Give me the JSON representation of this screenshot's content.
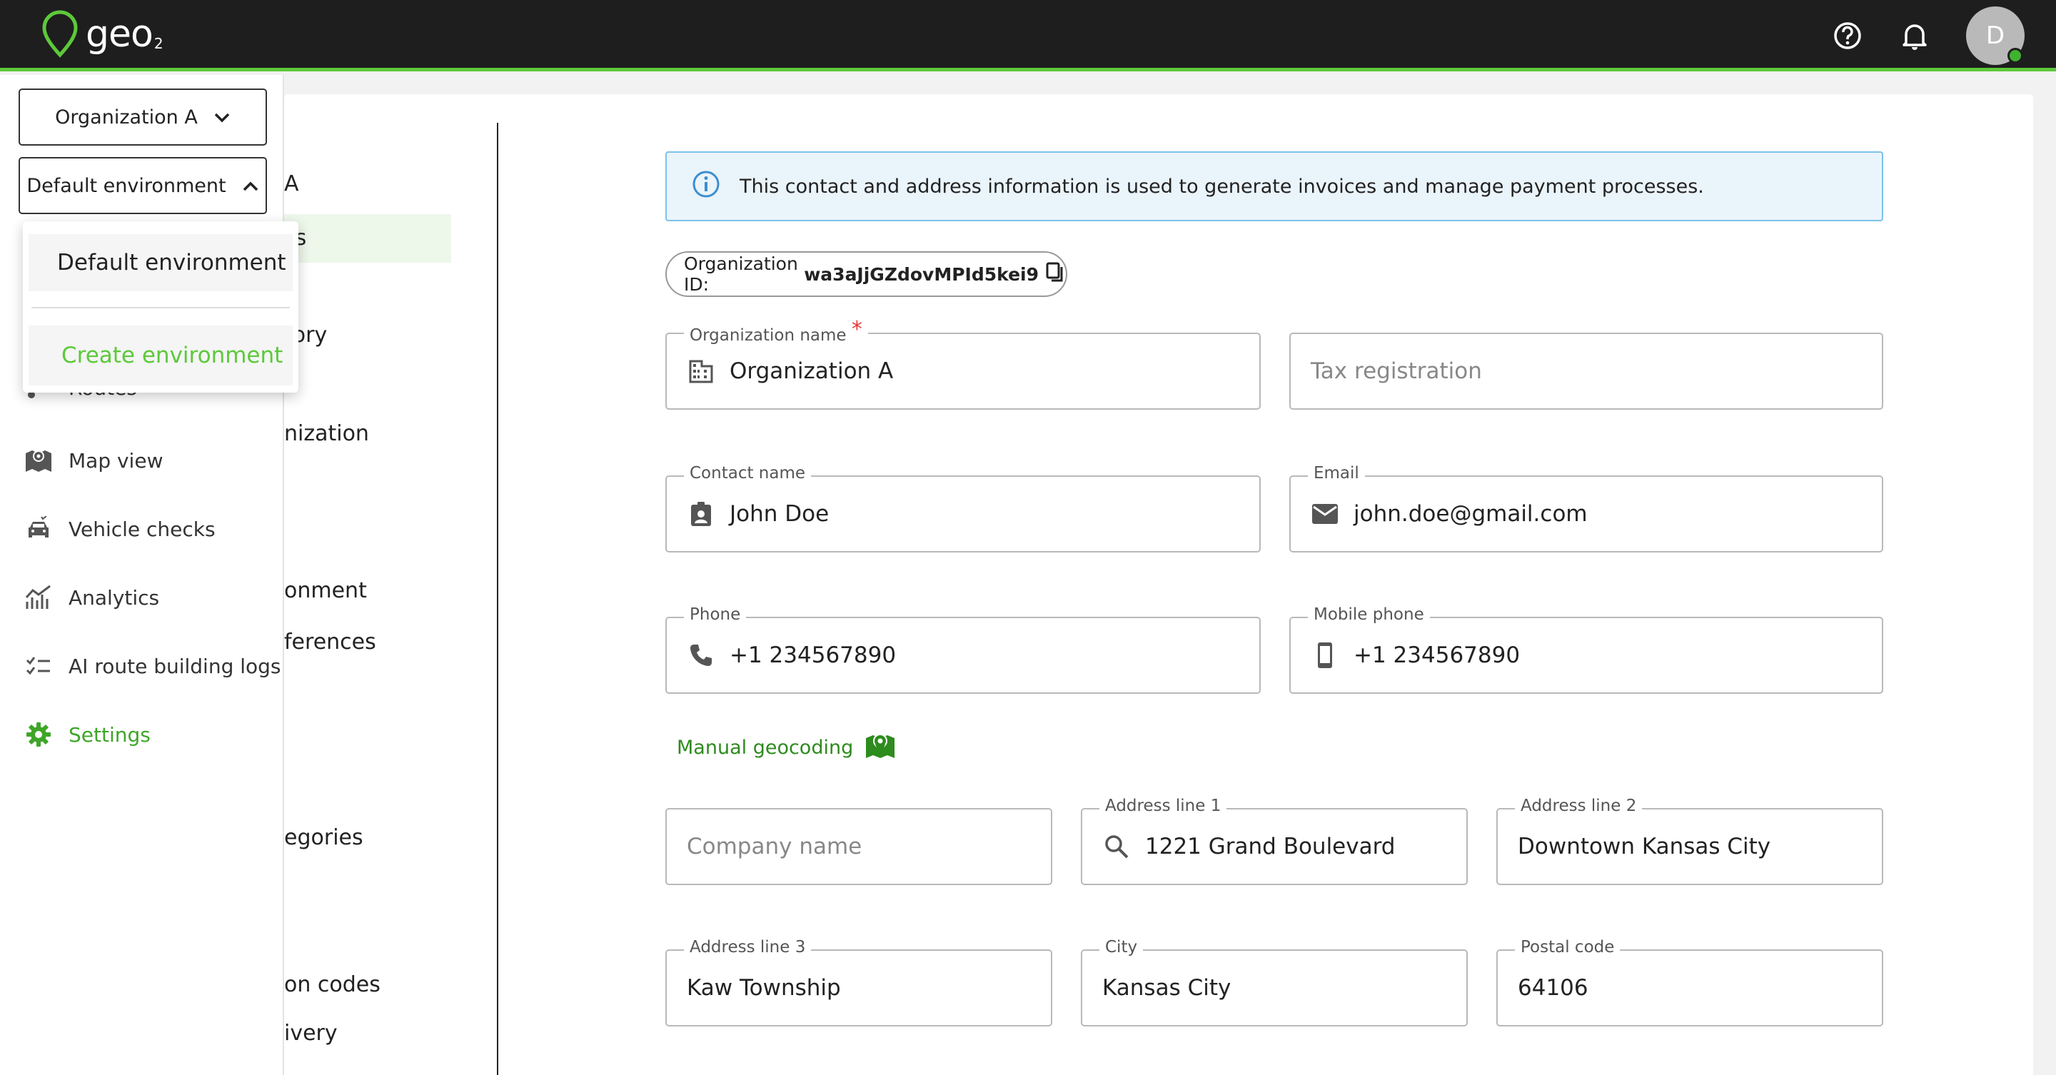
{
  "app": {
    "logo_text": "geo",
    "logo_sub": "2",
    "brand_color": "#5cc93a",
    "avatar_initial": "D"
  },
  "sidebar": {
    "org_select": "Organization A",
    "env_select": "Default environment",
    "items": [
      {
        "label": "Routes",
        "icon": "routes-icon"
      },
      {
        "label": "Map view",
        "icon": "map-view-icon"
      },
      {
        "label": "Vehicle checks",
        "icon": "vehicle-checks-icon"
      },
      {
        "label": "Analytics",
        "icon": "analytics-icon"
      },
      {
        "label": "AI route building logs",
        "icon": "ai-logs-icon"
      },
      {
        "label": "Settings",
        "icon": "gear-icon",
        "active": true
      }
    ]
  },
  "dropdown": {
    "option1": "Default environment",
    "option2": "Create environment"
  },
  "submenu": {
    "items": [
      "A",
      "ss",
      "s",
      "tory",
      "nization",
      "onment",
      "ferences",
      "egories",
      "on codes",
      "ivery"
    ]
  },
  "banner": {
    "text": "This contact and address information is used to generate invoices and manage payment processes."
  },
  "org_id": {
    "label": "Organization ID:",
    "value": "wa3aJjGZdovMPId5kei9"
  },
  "form": {
    "org_name": {
      "label": "Organization name",
      "required_mark": "*",
      "value": "Organization A"
    },
    "tax": {
      "placeholder": "Tax registration"
    },
    "contact": {
      "label": "Contact name",
      "value": "John Doe"
    },
    "email": {
      "label": "Email",
      "value": "john.doe@gmail.com"
    },
    "phone": {
      "label": "Phone",
      "value": "+1 234567890"
    },
    "mobile": {
      "label": "Mobile phone",
      "value": "+1 234567890"
    },
    "geocoding": "Manual geocoding",
    "company": {
      "placeholder": "Company name"
    },
    "addr1": {
      "label": "Address line 1",
      "value": "1221 Grand Boulevard"
    },
    "addr2": {
      "label": "Address line 2",
      "value": "Downtown Kansas City"
    },
    "addr3": {
      "label": "Address line 3",
      "value": "Kaw Township"
    },
    "city": {
      "label": "City",
      "value": "Kansas City"
    },
    "postal": {
      "label": "Postal code",
      "value": "64106"
    }
  }
}
